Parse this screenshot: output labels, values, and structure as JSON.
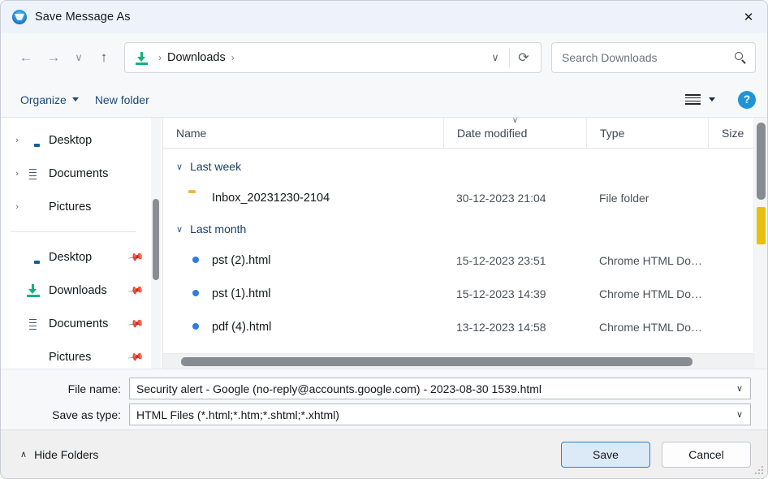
{
  "window": {
    "title": "Save Message As",
    "app_icon": "thunderbird-icon",
    "close_label": "✕"
  },
  "nav": {
    "back": "←",
    "forward": "→",
    "recent": "∨",
    "up": "↑",
    "dropdown": "∨",
    "refresh": "⟳"
  },
  "address": {
    "icon": "downloads-arrow-icon",
    "path": "Downloads",
    "separator": "›"
  },
  "search": {
    "placeholder": "Search Downloads",
    "value": "",
    "icon": "search-icon"
  },
  "toolbar": {
    "organize": "Organize",
    "new_folder": "New folder",
    "view_icon": "list-view-icon",
    "view_caret": "▾",
    "help": "?"
  },
  "sidebar": {
    "tree": [
      {
        "label": "Desktop",
        "icon": "desktop-icon",
        "chevron": "›",
        "expandable": true
      },
      {
        "label": "Documents",
        "icon": "documents-icon",
        "chevron": "›",
        "expandable": true
      },
      {
        "label": "Pictures",
        "icon": "pictures-icon",
        "chevron": "›",
        "expandable": true
      }
    ],
    "quick_access": [
      {
        "label": "Desktop",
        "icon": "desktop-icon",
        "pin": "📌"
      },
      {
        "label": "Downloads",
        "icon": "downloads-icon",
        "pin": "📌"
      },
      {
        "label": "Documents",
        "icon": "documents-icon",
        "pin": "📌"
      },
      {
        "label": "Pictures",
        "icon": "pictures-icon",
        "pin": "📌"
      }
    ]
  },
  "filelist": {
    "columns": {
      "name": "Name",
      "date_modified": "Date modified",
      "type": "Type",
      "size": "Size",
      "sort_indicator": "∨"
    },
    "groups": [
      {
        "label": "Last week",
        "chevron": "∨",
        "rows": [
          {
            "name": "Inbox_20231230-2104",
            "icon": "folder-icon",
            "date": "30-12-2023 21:04",
            "type": "File folder",
            "size": ""
          }
        ]
      },
      {
        "label": "Last month",
        "chevron": "∨",
        "rows": [
          {
            "name": "pst (2).html",
            "icon": "chrome-icon",
            "date": "15-12-2023 23:51",
            "type": "Chrome HTML Do…",
            "size": ""
          },
          {
            "name": "pst (1).html",
            "icon": "chrome-icon",
            "date": "15-12-2023 14:39",
            "type": "Chrome HTML Do…",
            "size": ""
          },
          {
            "name": "pdf (4).html",
            "icon": "chrome-icon",
            "date": "13-12-2023 14:58",
            "type": "Chrome HTML Do…",
            "size": ""
          }
        ]
      }
    ]
  },
  "form": {
    "file_name_label": "File name:",
    "file_name_value": "Security alert - Google (no-reply@accounts.google.com) - 2023-08-30 1539.html",
    "save_as_type_label": "Save as type:",
    "save_as_type_value": "HTML Files (*.html;*.htm;*.shtml;*.xhtml)",
    "dropdown_arrow": "∨"
  },
  "footer": {
    "hide_folders": "Hide Folders",
    "hide_folders_chevron": "∧",
    "save": "Save",
    "cancel": "Cancel"
  },
  "colors": {
    "titlebar": "#eef3fb",
    "accent": "#2a7fd0",
    "download_green": "#13b183",
    "help_blue": "#1e94d6",
    "scrollbar_mark": "#e5c10d"
  }
}
